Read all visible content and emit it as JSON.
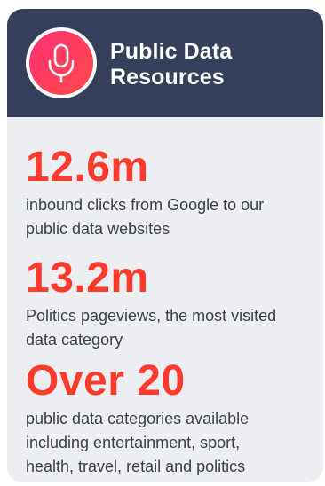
{
  "header": {
    "title_line1": "Public Data",
    "title_line2": "Resources",
    "icon": "microphone-icon",
    "colors": {
      "header_bg": "#363f59",
      "icon_gradient_start": "#ff2f73",
      "icon_gradient_end": "#ff4a4a"
    }
  },
  "stats": [
    {
      "value": "12.6m",
      "desc_line1": "inbound clicks from Google to our",
      "desc_line2": "public data websites"
    },
    {
      "value": "13.2m",
      "desc_line1": "Politics pageviews, the most visited",
      "desc_line2": "data category"
    },
    {
      "value": "Over 20",
      "desc_line1": "public data categories available",
      "desc_line2": "including entertainment, sport,",
      "desc_line3": "health, travel, retail and politics"
    }
  ],
  "colors": {
    "accent": "#ff3b2e",
    "card_bg": "#eceef2",
    "text": "#3a3f4b"
  }
}
